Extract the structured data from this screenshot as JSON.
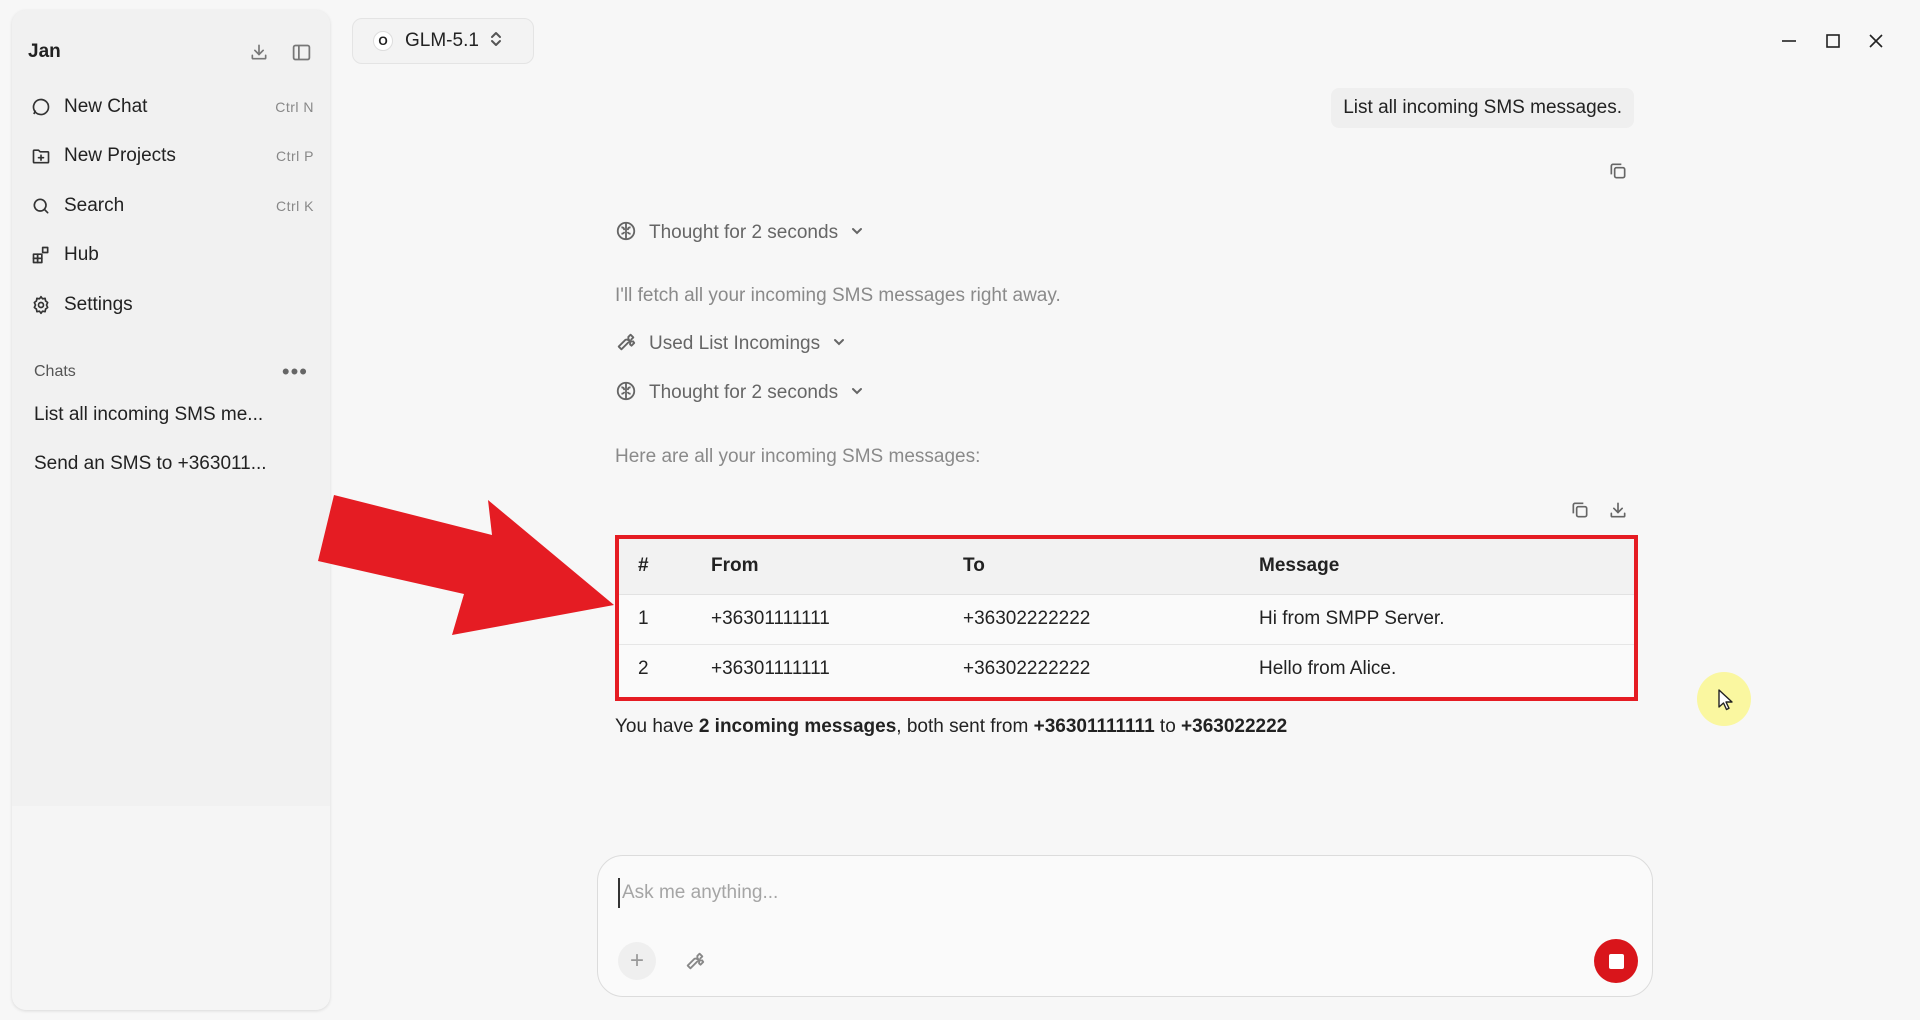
{
  "sidebar": {
    "title": "Jan",
    "nav": [
      {
        "label": "New Chat",
        "shortcut": "Ctrl  N",
        "icon": "chat-bubble-icon"
      },
      {
        "label": "New Projects",
        "shortcut": "Ctrl  P",
        "icon": "folder-plus-icon"
      },
      {
        "label": "Search",
        "shortcut": "Ctrl  K",
        "icon": "search-icon"
      },
      {
        "label": "Hub",
        "shortcut": "",
        "icon": "blocks-icon"
      },
      {
        "label": "Settings",
        "shortcut": "",
        "icon": "gear-icon"
      }
    ],
    "chats_label": "Chats",
    "chats": [
      {
        "title": "List all incoming SMS me..."
      },
      {
        "title": "Send an SMS to +363011..."
      }
    ]
  },
  "model": {
    "logo": "O",
    "name": "GLM-5.1"
  },
  "conversation": {
    "user_message": "List all incoming SMS messages.",
    "thought_1": "Thought for 2 seconds",
    "assistant_intro": "I'll fetch all your incoming SMS messages right away.",
    "tool_used": "Used List Incomings",
    "thought_2": "Thought for 2 seconds",
    "assistant_lead": "Here are all your incoming SMS messages:",
    "table": {
      "headers": [
        "#",
        "From",
        "To",
        "Message"
      ],
      "rows": [
        [
          "1",
          "+36301111111",
          "+36302222222",
          "Hi from SMPP Server."
        ],
        [
          "2",
          "+36301111111",
          "+36302222222",
          "Hello from Alice."
        ]
      ]
    },
    "summary": {
      "p1": "You have ",
      "b1": "2 incoming messages",
      "p2": ", both sent from ",
      "b2": "+36301111111",
      "p3": " to ",
      "b3": "+363022222"
    }
  },
  "composer": {
    "placeholder": "Ask me anything..."
  },
  "colors": {
    "highlight_red": "#e51c23",
    "stop_red": "#d9151b",
    "cursor_yellow": "#faf696"
  }
}
